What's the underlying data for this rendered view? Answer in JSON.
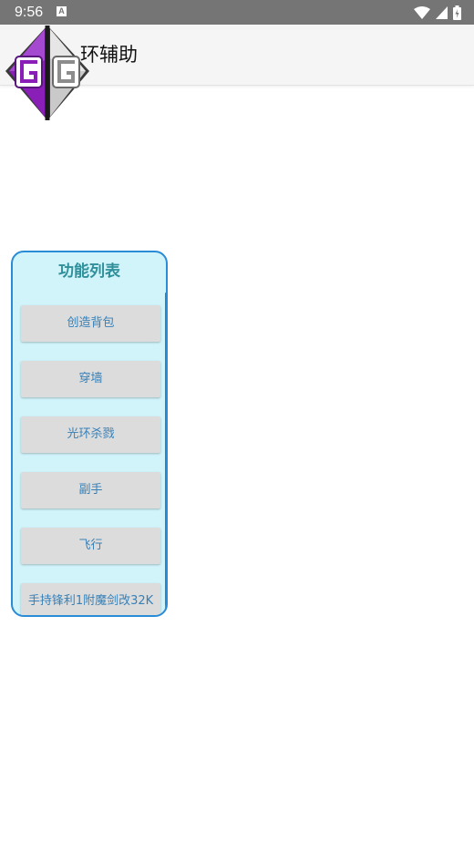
{
  "status_bar": {
    "time": "9:56",
    "notification_letter": "A"
  },
  "app_bar": {
    "title": "环辅助"
  },
  "panel": {
    "title": "功能列表",
    "buttons": [
      "创造背包",
      "穿墙",
      "光环杀戮",
      "副手",
      "飞行",
      "手持锋利1附魔剑改32K"
    ]
  },
  "colors": {
    "status_bar": "#757575",
    "panel_bg": "#d1f4fb",
    "panel_border": "#2a8bd6",
    "button_text": "#3680b8"
  }
}
